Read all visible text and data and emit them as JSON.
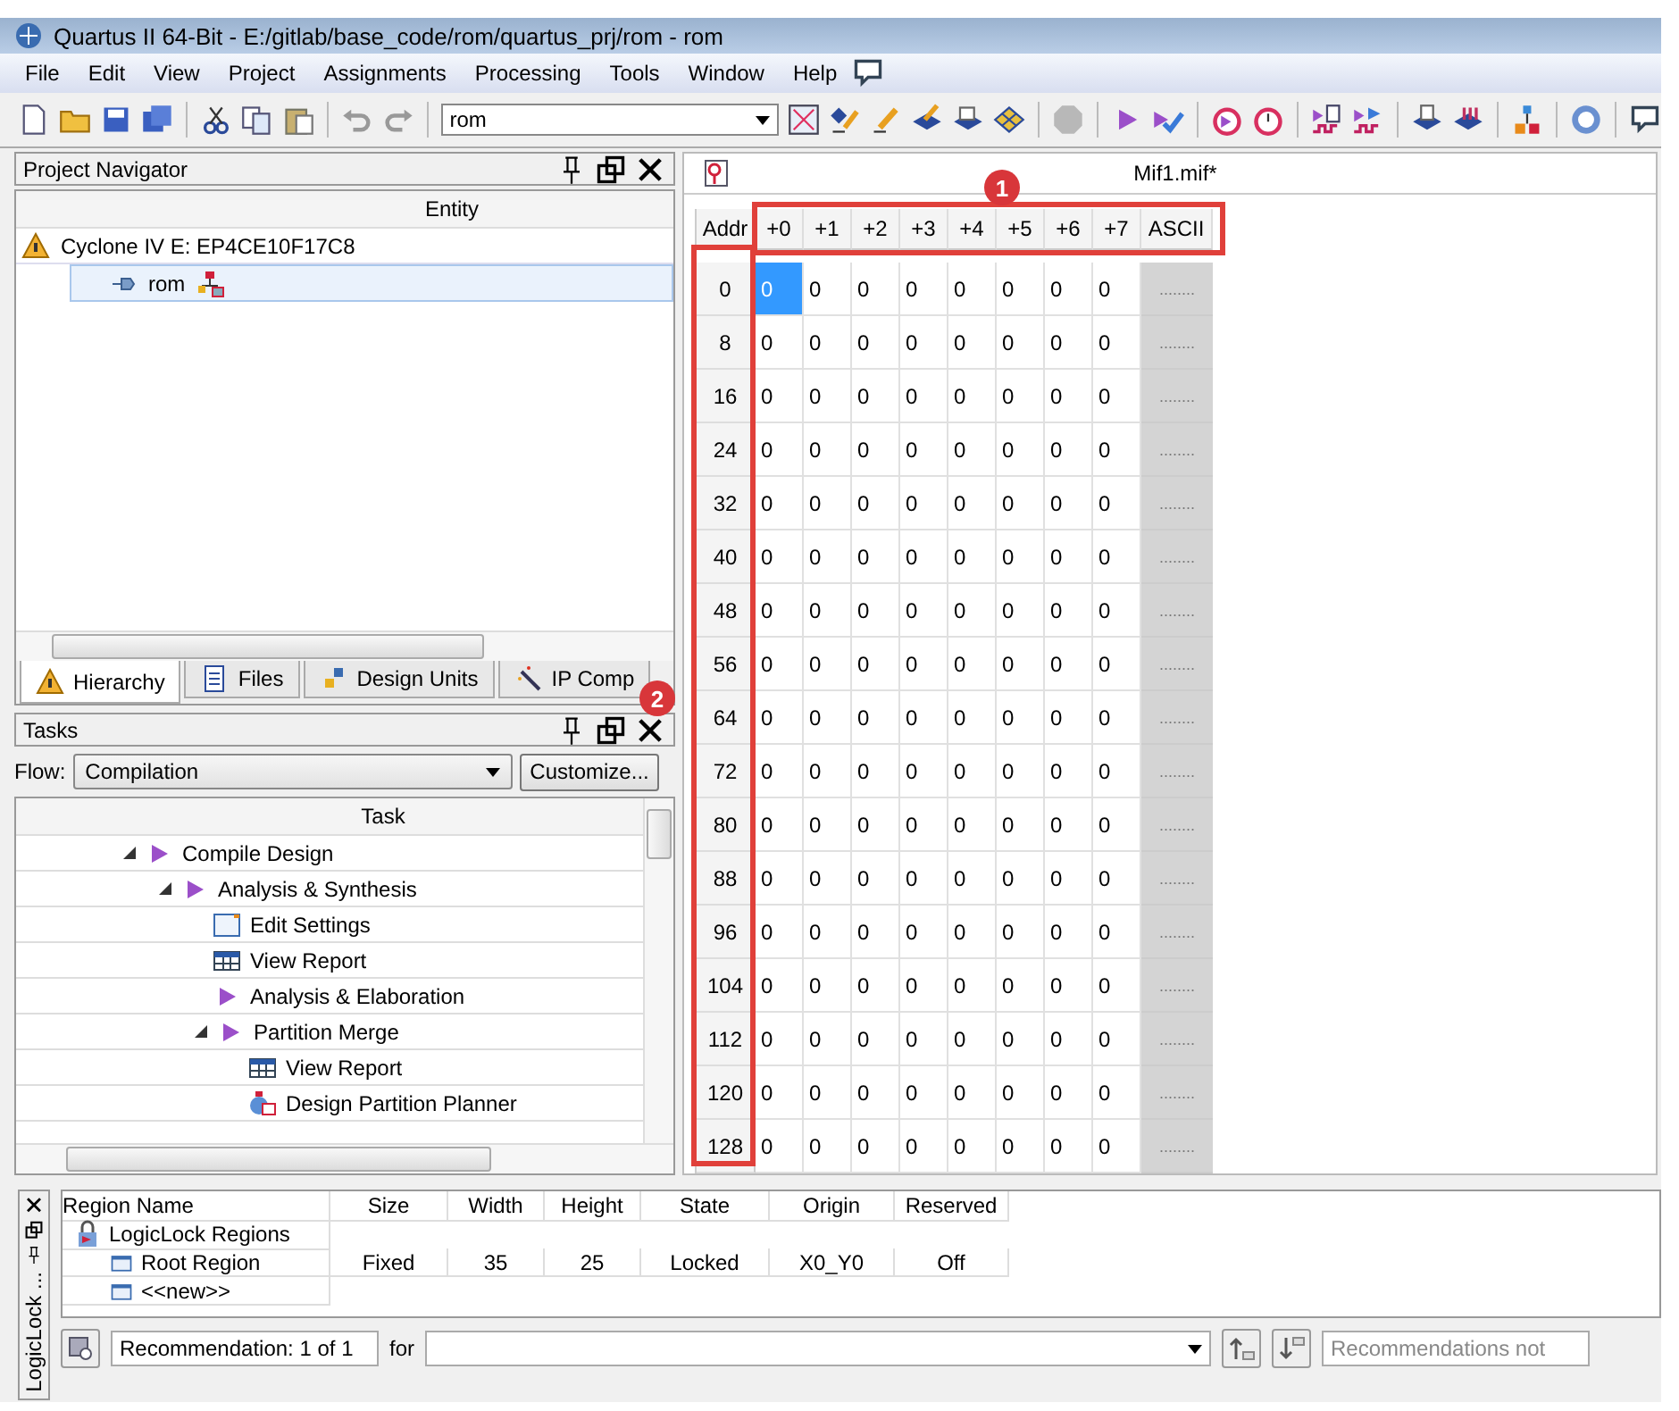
{
  "window": {
    "title": "Quartus II 64-Bit - E:/gitlab/base_code/rom/quartus_prj/rom - rom"
  },
  "menu": [
    "File",
    "Edit",
    "View",
    "Project",
    "Assignments",
    "Processing",
    "Tools",
    "Window",
    "Help"
  ],
  "toolbar": {
    "project_select": "rom"
  },
  "project_navigator": {
    "title": "Project Navigator",
    "column": "Entity",
    "tree": [
      {
        "label": "Cyclone IV E: EP4CE10F17C8",
        "kind": "device",
        "selected": false,
        "children": [
          {
            "label": "rom",
            "kind": "entity",
            "selected": true
          }
        ]
      }
    ],
    "tabs": [
      {
        "label": "Hierarchy",
        "kind": "hierarchy",
        "selected": true
      },
      {
        "label": "Files",
        "kind": "files",
        "selected": false
      },
      {
        "label": "Design Units",
        "kind": "units",
        "selected": false
      },
      {
        "label": "IP Comp",
        "kind": "ip",
        "selected": false
      }
    ]
  },
  "tasks": {
    "title": "Tasks",
    "flow_label": "Flow:",
    "flow": "Compilation",
    "customize_button": "Customize...",
    "column": "Task",
    "tree": [
      {
        "label": "Compile Design",
        "kind": "run",
        "expanded": true,
        "children": [
          {
            "label": "Analysis & Synthesis",
            "kind": "run",
            "expanded": true,
            "children": [
              {
                "label": "Edit Settings",
                "kind": "settings"
              },
              {
                "label": "View Report",
                "kind": "report"
              },
              {
                "label": "Analysis & Elaboration",
                "kind": "run"
              },
              {
                "label": "Partition Merge",
                "kind": "run",
                "expanded": true,
                "children": [
                  {
                    "label": "View Report",
                    "kind": "report"
                  },
                  {
                    "label": "Design Partition Planner",
                    "kind": "planner"
                  }
                ]
              }
            ]
          }
        ]
      }
    ]
  },
  "editor": {
    "title": "Mif1.mif*",
    "columns": [
      "Addr",
      "+0",
      "+1",
      "+2",
      "+3",
      "+4",
      "+5",
      "+6",
      "+7",
      "ASCII"
    ],
    "rows": [
      {
        "addr": "0",
        "cells": [
          {
            "v": "0",
            "selected": true
          },
          {
            "v": "0",
            "selected": false
          },
          {
            "v": "0",
            "selected": false
          },
          {
            "v": "0",
            "selected": false
          },
          {
            "v": "0",
            "selected": false
          },
          {
            "v": "0",
            "selected": false
          },
          {
            "v": "0",
            "selected": false
          },
          {
            "v": "0",
            "selected": false
          }
        ],
        "ascii": "........"
      },
      {
        "addr": "8",
        "cells": [
          {
            "v": "0",
            "selected": false
          },
          {
            "v": "0",
            "selected": false
          },
          {
            "v": "0",
            "selected": false
          },
          {
            "v": "0",
            "selected": false
          },
          {
            "v": "0",
            "selected": false
          },
          {
            "v": "0",
            "selected": false
          },
          {
            "v": "0",
            "selected": false
          },
          {
            "v": "0",
            "selected": false
          }
        ],
        "ascii": "........"
      },
      {
        "addr": "16",
        "cells": [
          {
            "v": "0",
            "selected": false
          },
          {
            "v": "0",
            "selected": false
          },
          {
            "v": "0",
            "selected": false
          },
          {
            "v": "0",
            "selected": false
          },
          {
            "v": "0",
            "selected": false
          },
          {
            "v": "0",
            "selected": false
          },
          {
            "v": "0",
            "selected": false
          },
          {
            "v": "0",
            "selected": false
          }
        ],
        "ascii": "........"
      },
      {
        "addr": "24",
        "cells": [
          {
            "v": "0",
            "selected": false
          },
          {
            "v": "0",
            "selected": false
          },
          {
            "v": "0",
            "selected": false
          },
          {
            "v": "0",
            "selected": false
          },
          {
            "v": "0",
            "selected": false
          },
          {
            "v": "0",
            "selected": false
          },
          {
            "v": "0",
            "selected": false
          },
          {
            "v": "0",
            "selected": false
          }
        ],
        "ascii": "........"
      },
      {
        "addr": "32",
        "cells": [
          {
            "v": "0",
            "selected": false
          },
          {
            "v": "0",
            "selected": false
          },
          {
            "v": "0",
            "selected": false
          },
          {
            "v": "0",
            "selected": false
          },
          {
            "v": "0",
            "selected": false
          },
          {
            "v": "0",
            "selected": false
          },
          {
            "v": "0",
            "selected": false
          },
          {
            "v": "0",
            "selected": false
          }
        ],
        "ascii": "........"
      },
      {
        "addr": "40",
        "cells": [
          {
            "v": "0",
            "selected": false
          },
          {
            "v": "0",
            "selected": false
          },
          {
            "v": "0",
            "selected": false
          },
          {
            "v": "0",
            "selected": false
          },
          {
            "v": "0",
            "selected": false
          },
          {
            "v": "0",
            "selected": false
          },
          {
            "v": "0",
            "selected": false
          },
          {
            "v": "0",
            "selected": false
          }
        ],
        "ascii": "........"
      },
      {
        "addr": "48",
        "cells": [
          {
            "v": "0",
            "selected": false
          },
          {
            "v": "0",
            "selected": false
          },
          {
            "v": "0",
            "selected": false
          },
          {
            "v": "0",
            "selected": false
          },
          {
            "v": "0",
            "selected": false
          },
          {
            "v": "0",
            "selected": false
          },
          {
            "v": "0",
            "selected": false
          },
          {
            "v": "0",
            "selected": false
          }
        ],
        "ascii": "........"
      },
      {
        "addr": "56",
        "cells": [
          {
            "v": "0",
            "selected": false
          },
          {
            "v": "0",
            "selected": false
          },
          {
            "v": "0",
            "selected": false
          },
          {
            "v": "0",
            "selected": false
          },
          {
            "v": "0",
            "selected": false
          },
          {
            "v": "0",
            "selected": false
          },
          {
            "v": "0",
            "selected": false
          },
          {
            "v": "0",
            "selected": false
          }
        ],
        "ascii": "........"
      },
      {
        "addr": "64",
        "cells": [
          {
            "v": "0",
            "selected": false
          },
          {
            "v": "0",
            "selected": false
          },
          {
            "v": "0",
            "selected": false
          },
          {
            "v": "0",
            "selected": false
          },
          {
            "v": "0",
            "selected": false
          },
          {
            "v": "0",
            "selected": false
          },
          {
            "v": "0",
            "selected": false
          },
          {
            "v": "0",
            "selected": false
          }
        ],
        "ascii": "........"
      },
      {
        "addr": "72",
        "cells": [
          {
            "v": "0",
            "selected": false
          },
          {
            "v": "0",
            "selected": false
          },
          {
            "v": "0",
            "selected": false
          },
          {
            "v": "0",
            "selected": false
          },
          {
            "v": "0",
            "selected": false
          },
          {
            "v": "0",
            "selected": false
          },
          {
            "v": "0",
            "selected": false
          },
          {
            "v": "0",
            "selected": false
          }
        ],
        "ascii": "........"
      },
      {
        "addr": "80",
        "cells": [
          {
            "v": "0",
            "selected": false
          },
          {
            "v": "0",
            "selected": false
          },
          {
            "v": "0",
            "selected": false
          },
          {
            "v": "0",
            "selected": false
          },
          {
            "v": "0",
            "selected": false
          },
          {
            "v": "0",
            "selected": false
          },
          {
            "v": "0",
            "selected": false
          },
          {
            "v": "0",
            "selected": false
          }
        ],
        "ascii": "........"
      },
      {
        "addr": "88",
        "cells": [
          {
            "v": "0",
            "selected": false
          },
          {
            "v": "0",
            "selected": false
          },
          {
            "v": "0",
            "selected": false
          },
          {
            "v": "0",
            "selected": false
          },
          {
            "v": "0",
            "selected": false
          },
          {
            "v": "0",
            "selected": false
          },
          {
            "v": "0",
            "selected": false
          },
          {
            "v": "0",
            "selected": false
          }
        ],
        "ascii": "........"
      },
      {
        "addr": "96",
        "cells": [
          {
            "v": "0",
            "selected": false
          },
          {
            "v": "0",
            "selected": false
          },
          {
            "v": "0",
            "selected": false
          },
          {
            "v": "0",
            "selected": false
          },
          {
            "v": "0",
            "selected": false
          },
          {
            "v": "0",
            "selected": false
          },
          {
            "v": "0",
            "selected": false
          },
          {
            "v": "0",
            "selected": false
          }
        ],
        "ascii": "........"
      },
      {
        "addr": "104",
        "cells": [
          {
            "v": "0",
            "selected": false
          },
          {
            "v": "0",
            "selected": false
          },
          {
            "v": "0",
            "selected": false
          },
          {
            "v": "0",
            "selected": false
          },
          {
            "v": "0",
            "selected": false
          },
          {
            "v": "0",
            "selected": false
          },
          {
            "v": "0",
            "selected": false
          },
          {
            "v": "0",
            "selected": false
          }
        ],
        "ascii": "........"
      },
      {
        "addr": "112",
        "cells": [
          {
            "v": "0",
            "selected": false
          },
          {
            "v": "0",
            "selected": false
          },
          {
            "v": "0",
            "selected": false
          },
          {
            "v": "0",
            "selected": false
          },
          {
            "v": "0",
            "selected": false
          },
          {
            "v": "0",
            "selected": false
          },
          {
            "v": "0",
            "selected": false
          },
          {
            "v": "0",
            "selected": false
          }
        ],
        "ascii": "........"
      },
      {
        "addr": "120",
        "cells": [
          {
            "v": "0",
            "selected": false
          },
          {
            "v": "0",
            "selected": false
          },
          {
            "v": "0",
            "selected": false
          },
          {
            "v": "0",
            "selected": false
          },
          {
            "v": "0",
            "selected": false
          },
          {
            "v": "0",
            "selected": false
          },
          {
            "v": "0",
            "selected": false
          },
          {
            "v": "0",
            "selected": false
          }
        ],
        "ascii": "........"
      },
      {
        "addr": "128",
        "cells": [
          {
            "v": "0",
            "selected": false
          },
          {
            "v": "0",
            "selected": false
          },
          {
            "v": "0",
            "selected": false
          },
          {
            "v": "0",
            "selected": false
          },
          {
            "v": "0",
            "selected": false
          },
          {
            "v": "0",
            "selected": false
          },
          {
            "v": "0",
            "selected": false
          },
          {
            "v": "0",
            "selected": false
          }
        ],
        "ascii": "........"
      }
    ]
  },
  "annotations": [
    {
      "label": "1"
    },
    {
      "label": "2"
    }
  ],
  "logiclock": {
    "tab": "LogicLock ...",
    "columns": [
      "Region Name",
      "Size",
      "Width",
      "Height",
      "State",
      "Origin",
      "Reserved"
    ],
    "rows": [
      {
        "name": "LogicLock Regions",
        "kind": "group",
        "children": [
          {
            "name": "Root Region",
            "kind": "region",
            "cells": [
              "Fixed",
              "35",
              "25",
              "Locked",
              "X0_Y0",
              "Off"
            ]
          },
          {
            "name": "<<new>>",
            "kind": "region"
          }
        ]
      }
    ],
    "recommendation": "Recommendation: 1 of 1",
    "for_label": "for",
    "recommendations_field": "Recommendations not"
  }
}
